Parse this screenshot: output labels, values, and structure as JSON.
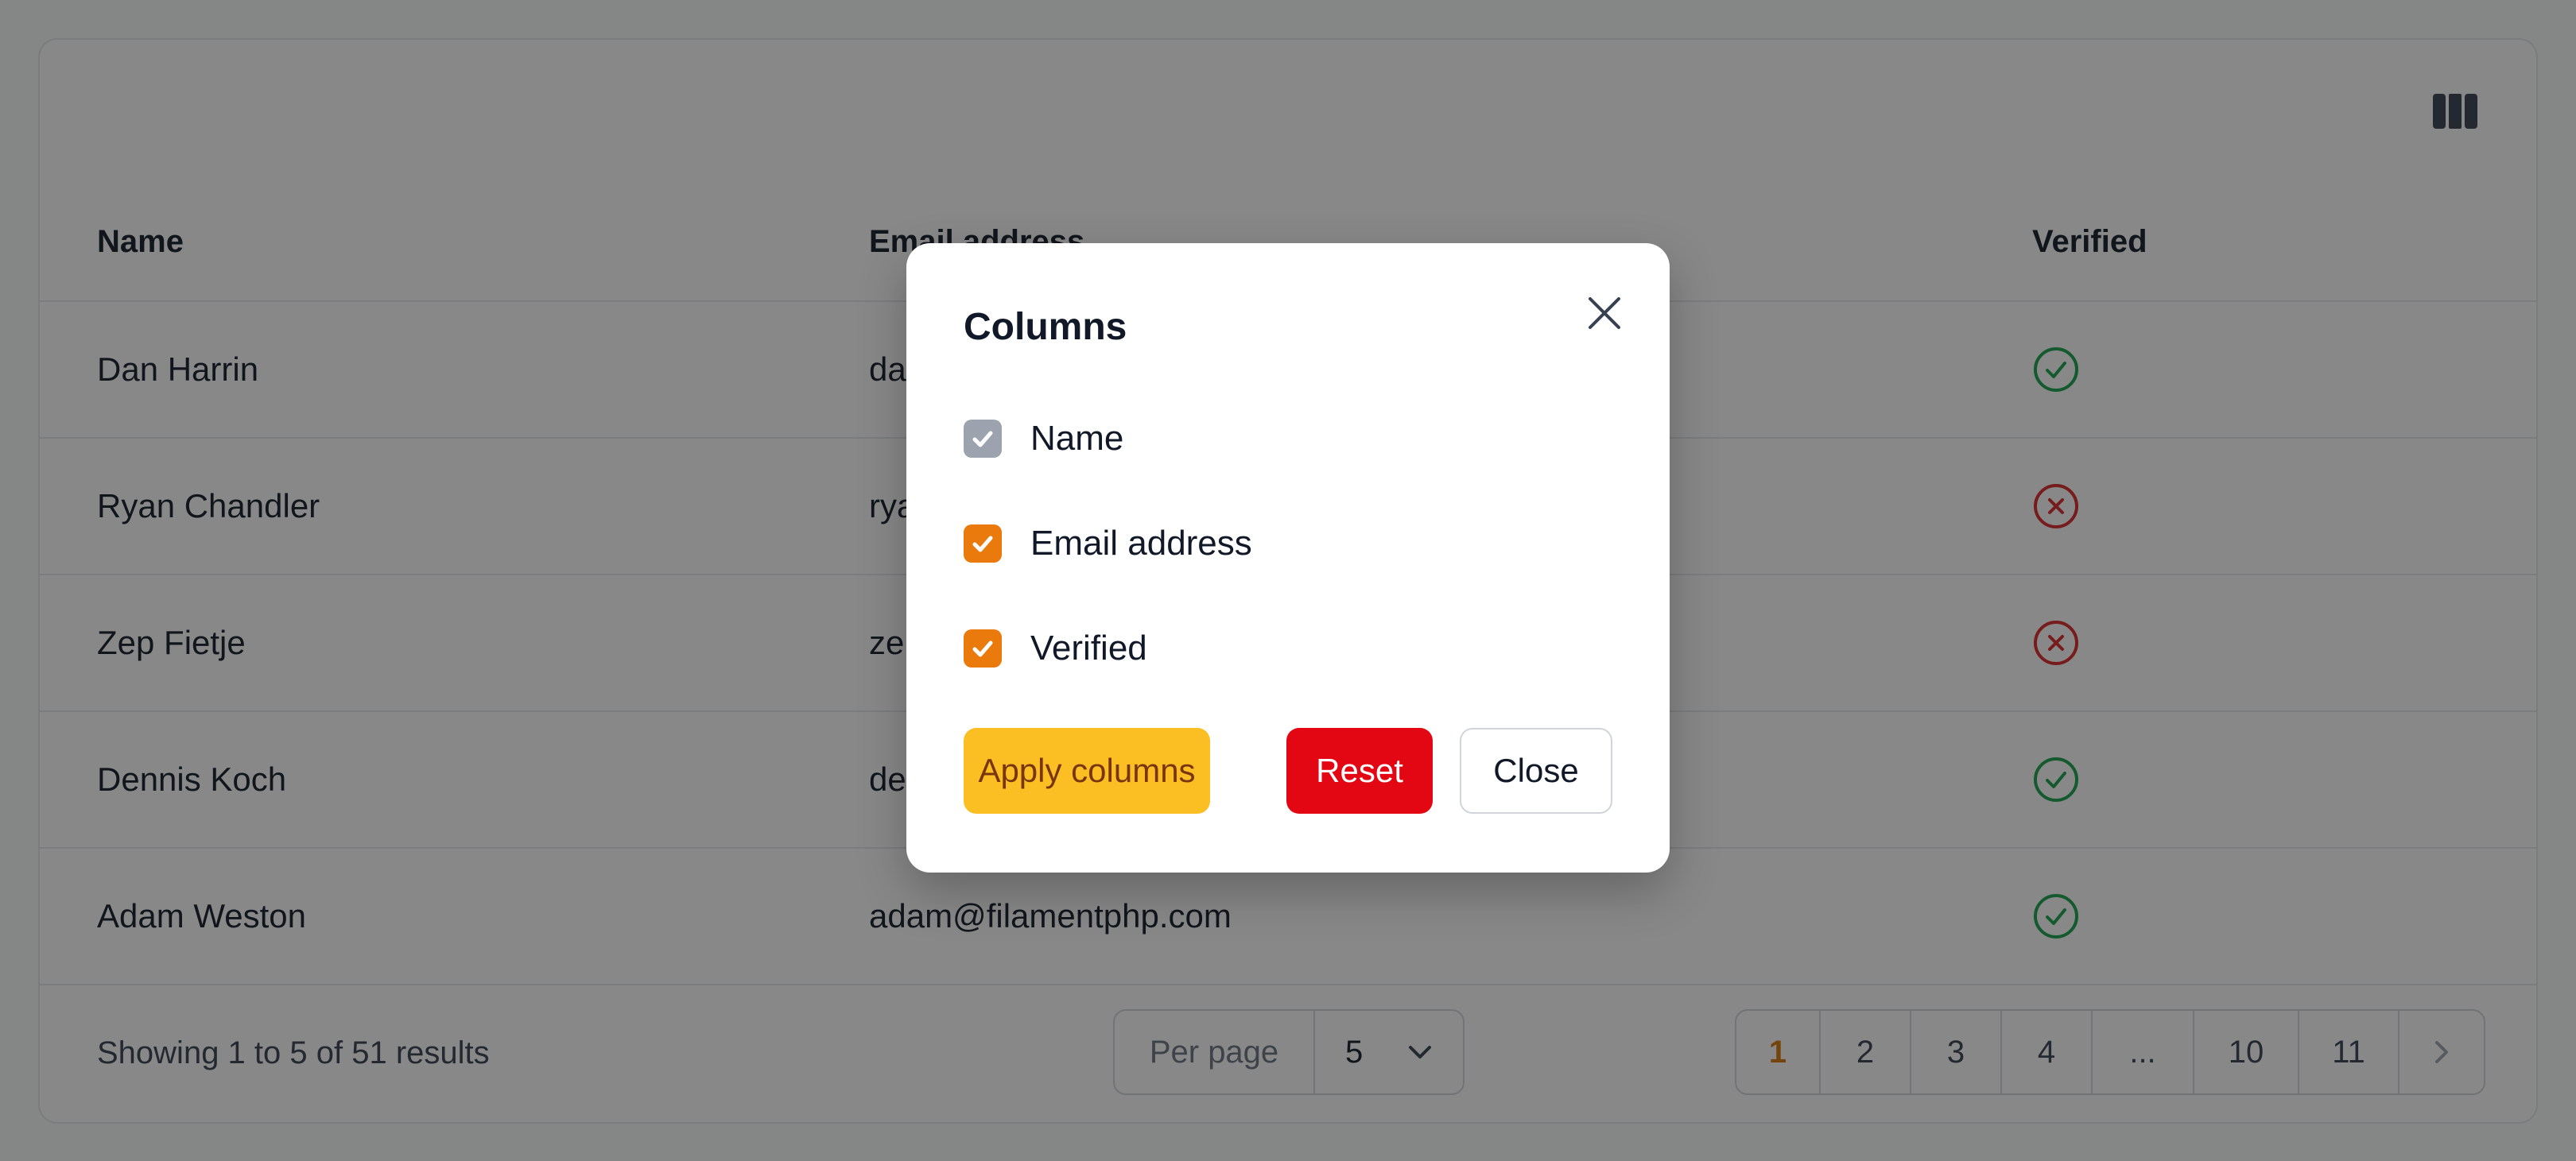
{
  "table": {
    "columns": {
      "name": "Name",
      "email": "Email address",
      "verified": "Verified"
    },
    "rows": [
      {
        "name": "Dan Harrin",
        "email": "da",
        "verified": true
      },
      {
        "name": "Ryan Chandler",
        "email": "rya",
        "verified": false
      },
      {
        "name": "Zep Fietje",
        "email": "ze",
        "verified": false
      },
      {
        "name": "Dennis Koch",
        "email": "de",
        "verified": true
      },
      {
        "name": "Adam Weston",
        "email": "adam@filamentphp.com",
        "verified": true
      }
    ]
  },
  "footer": {
    "results_text": "Showing 1 to 5 of 51 results",
    "per_page_label": "Per page",
    "per_page_value": "5",
    "pages": [
      "1",
      "2",
      "3",
      "4",
      "...",
      "10",
      "11"
    ],
    "active_page": "1"
  },
  "modal": {
    "title": "Columns",
    "options": [
      {
        "label": "Name",
        "checked": true,
        "disabled": true
      },
      {
        "label": "Email address",
        "checked": true,
        "disabled": false
      },
      {
        "label": "Verified",
        "checked": true,
        "disabled": false
      }
    ],
    "apply_label": "Apply columns",
    "reset_label": "Reset",
    "close_label": "Close"
  },
  "colors": {
    "accent": "#d97706",
    "checkbox": "#ea7a0b",
    "checkbox_disabled": "#9ca3af",
    "apply": "#fbbf24",
    "reset": "#e30613",
    "success": "#16a34a",
    "danger": "#dc2626"
  },
  "icons": {
    "column_toggle": "columns-icon",
    "verified_true": "check-circle-icon",
    "verified_false": "x-circle-icon",
    "close": "close-icon",
    "per_page_chevron": "chevron-down-icon",
    "pager_next": "chevron-right-icon"
  }
}
